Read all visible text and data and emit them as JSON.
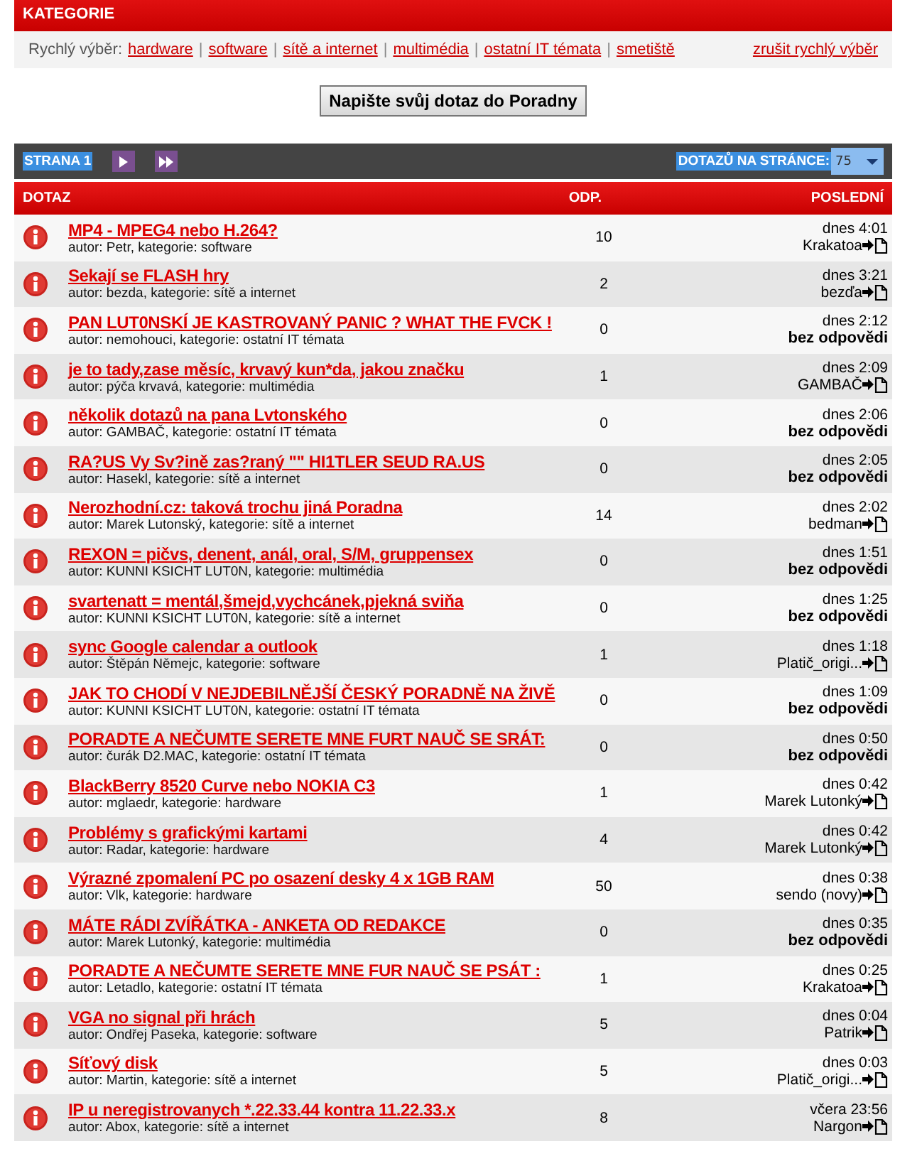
{
  "categories": {
    "title": "KATEGORIE",
    "quick_label": "Rychlý výběr:",
    "links": [
      "hardware",
      "software",
      "sítě a internet",
      "multimédia",
      "ostatní IT témata",
      "smetiště"
    ],
    "separator": "|",
    "cancel": "zrušit rychlý výběr"
  },
  "ask_button": "Napište svůj dotaz do Poradny",
  "pager": {
    "page": "STRANA 1",
    "per_page_label": "DOTAZŮ NA STRÁNCE:",
    "per_page": "75"
  },
  "table": {
    "columns": [
      "DOTAZ",
      "ODP.",
      "POSLEDNÍ"
    ],
    "rows": [
      {
        "title": "MP4 - MPEG4 nebo H.264?",
        "meta": "autor: Petr, kategorie: software",
        "replies": "10",
        "time": "dnes 4:01",
        "last": "Krakatoa",
        "kind": "user"
      },
      {
        "title": "Sekají se FLASH hry",
        "meta": "autor: bezda, kategorie: sítě a internet",
        "replies": "2",
        "time": "dnes 3:21",
        "last": "bezďa",
        "kind": "user"
      },
      {
        "title": "PAN LUT0NSKÍ JE KASTROVANÝ PANIC ? WHAT THE FVCK !",
        "meta": "autor: nemohouci, kategorie: ostatní IT témata",
        "replies": "0",
        "time": "dnes 2:12",
        "last": "bez odpovědi",
        "kind": "none"
      },
      {
        "title": "je to tady,zase měsíc, krvavý kun*da, jakou značku",
        "meta": "autor: pýča krvavá, kategorie: multimédia",
        "replies": "1",
        "time": "dnes 2:09",
        "last": "GAMBAČ",
        "kind": "user"
      },
      {
        "title": "několik dotazů na pana Lvtonského",
        "meta": "autor: GAMBAČ, kategorie: ostatní IT témata",
        "replies": "0",
        "time": "dnes 2:06",
        "last": "bez odpovědi",
        "kind": "none"
      },
      {
        "title": "RA?US Vy Sv?ině zas?raný \"\" HI1TLER SEUD RA.US",
        "meta": "autor: Hasekl, kategorie: sítě a internet",
        "replies": "0",
        "time": "dnes 2:05",
        "last": "bez odpovědi",
        "kind": "none"
      },
      {
        "title": "Nerozhodní.cz: taková trochu jiná Poradna",
        "meta": "autor: Marek Lutonský, kategorie: sítě a internet",
        "replies": "14",
        "time": "dnes 2:02",
        "last": "bedman",
        "kind": "user"
      },
      {
        "title": "REXON = pičvs, denent, anál, oral, S/M, gruppensex",
        "meta": "autor: KUNNI KSICHT LUT0N, kategorie: multimédia",
        "replies": "0",
        "time": "dnes 1:51",
        "last": "bez odpovědi",
        "kind": "none"
      },
      {
        "title": "svartenatt = mentál,šmejd,vychcánek,pjekná sviňa",
        "meta": "autor: KUNNI KSICHT LUT0N, kategorie: sítě a internet",
        "replies": "0",
        "time": "dnes 1:25",
        "last": "bez odpovědi",
        "kind": "none"
      },
      {
        "title": "sync Google calendar a outlook",
        "meta": "autor: Štěpán Němejc, kategorie: software",
        "replies": "1",
        "time": "dnes 1:18",
        "last": "Platič_origi...",
        "kind": "user"
      },
      {
        "title": "JAK TO CHODÍ V NEJDEBILNĚJŠÍ ČESKÝ PORADNĚ NA ŽIVĚ",
        "meta": "autor: KUNNI KSICHT LUT0N, kategorie: ostatní IT témata",
        "replies": "0",
        "time": "dnes 1:09",
        "last": "bez odpovědi",
        "kind": "none"
      },
      {
        "title": "PORADTE A NEČUMTE SERETE MNE FURT NAUČ SE SRÁT:",
        "meta": "autor: čurák D2.MAC, kategorie: ostatní IT témata",
        "replies": "0",
        "time": "dnes 0:50",
        "last": "bez odpovědi",
        "kind": "none"
      },
      {
        "title": "BlackBerry 8520 Curve nebo NOKIA C3",
        "meta": "autor: mglaedr, kategorie: hardware",
        "replies": "1",
        "time": "dnes 0:42",
        "last": "Marek Lutonký",
        "kind": "user"
      },
      {
        "title": "Problémy s grafickými kartami",
        "meta": "autor: Radar, kategorie: hardware",
        "replies": "4",
        "time": "dnes 0:42",
        "last": "Marek Lutonký",
        "kind": "user"
      },
      {
        "title": "Výrazné zpomalení PC po osazení desky 4 x 1GB RAM",
        "meta": "autor: Vlk, kategorie: hardware",
        "replies": "50",
        "time": "dnes 0:38",
        "last": "sendo (novy)",
        "kind": "user"
      },
      {
        "title": "MÁTE RÁDI ZVÍŘÁTKA - ANKETA OD REDAKCE",
        "meta": "autor: Marek Lutonký, kategorie: multimédia",
        "replies": "0",
        "time": "dnes 0:35",
        "last": "bez odpovědi",
        "kind": "none"
      },
      {
        "title": "PORADTE A NEČUMTE SERETE MNE FUR NAUČ SE PSÁT :",
        "meta": "autor: Letadlo, kategorie: ostatní IT témata",
        "replies": "1",
        "time": "dnes 0:25",
        "last": "Krakatoa",
        "kind": "user"
      },
      {
        "title": "VGA no signal při hrách",
        "meta": "autor: Ondřej Paseka, kategorie: software",
        "replies": "5",
        "time": "dnes 0:04",
        "last": "Patrik",
        "kind": "user"
      },
      {
        "title": "Síťový disk",
        "meta": "autor: Martin, kategorie: sítě a internet",
        "replies": "5",
        "time": "dnes 0:03",
        "last": "Platič_origi...",
        "kind": "user"
      },
      {
        "title": "IP u neregistrovanych *.22.33.44 kontra 11.22.33.x",
        "meta": "autor: Abox, kategorie: sítě a internet",
        "replies": "8",
        "time": "včera 23:56",
        "last": "Nargon",
        "kind": "user"
      }
    ]
  }
}
